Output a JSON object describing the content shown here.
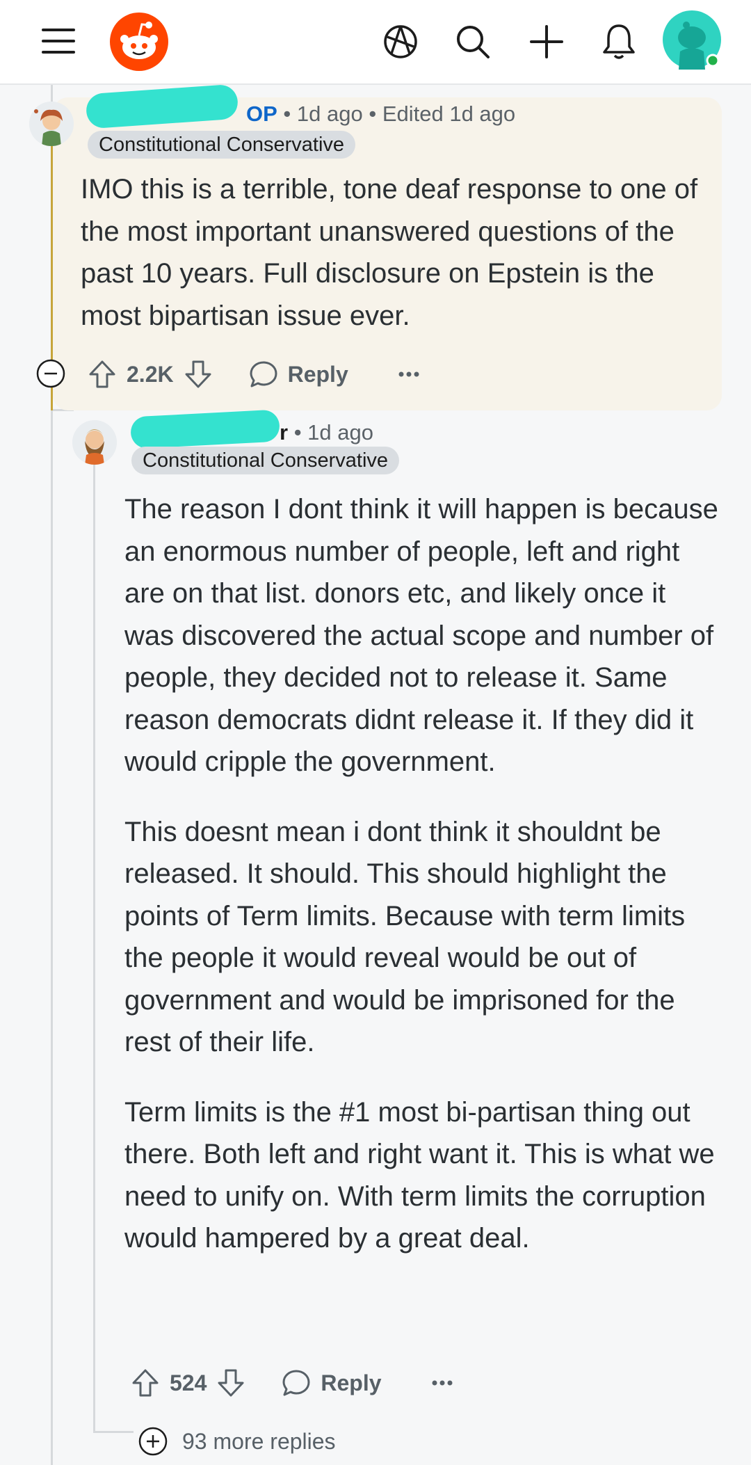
{
  "comment_op": {
    "badge": "OP",
    "time": "1d ago",
    "edited": "Edited 1d ago",
    "flair": "Constitutional Conservative",
    "body": "IMO this is a terrible, tone deaf response to one of the most important unanswered questions of the past 10 years. Full disclosure on Epstein is the most bipartisan issue ever.",
    "score": "2.2K",
    "reply_label": "Reply"
  },
  "comment_reply": {
    "username_visible_end": "r",
    "time": "1d ago",
    "flair": "Constitutional Conservative",
    "paragraphs": [
      "The reason I dont think it will happen is because an enormous number of people, left and right are on that list. donors etc, and likely once it was discovered the actual scope and number of people, they decided not to release it. Same reason democrats didnt release it. If they did it would cripple the government.",
      "This doesnt mean i dont think it shouldnt be released. It should. This should highlight the points of Term limits. Because with term limits the people it would reveal would be out of government and would be imprisoned for the rest of their life.",
      "Term limits is the #1 most bi-partisan thing out there. Both left and right want it. This is what we need to unify on. With term limits the corruption would hampered by a great deal."
    ],
    "score": "524",
    "reply_label": "Reply"
  },
  "more_replies": "93 more replies",
  "colors": {
    "brand": "#ff4500",
    "op_blue": "#0e66c9",
    "op_bg": "#f7f3ea",
    "redaction": "#34e2cf"
  }
}
